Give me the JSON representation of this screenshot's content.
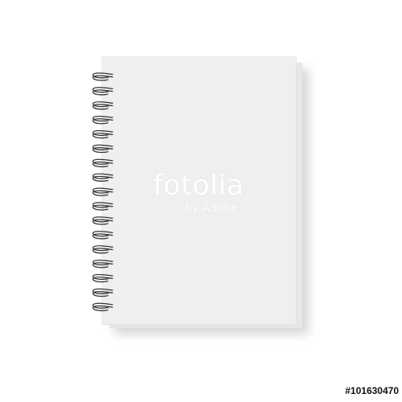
{
  "watermark": {
    "brand": "fotolia",
    "tagline": "by Adobe"
  },
  "image_id": "#101630470",
  "notebook": {
    "cover_color": "#efefef",
    "back_color": "#e7e7e7",
    "ring_color": "#333333",
    "ring_count": 17
  }
}
